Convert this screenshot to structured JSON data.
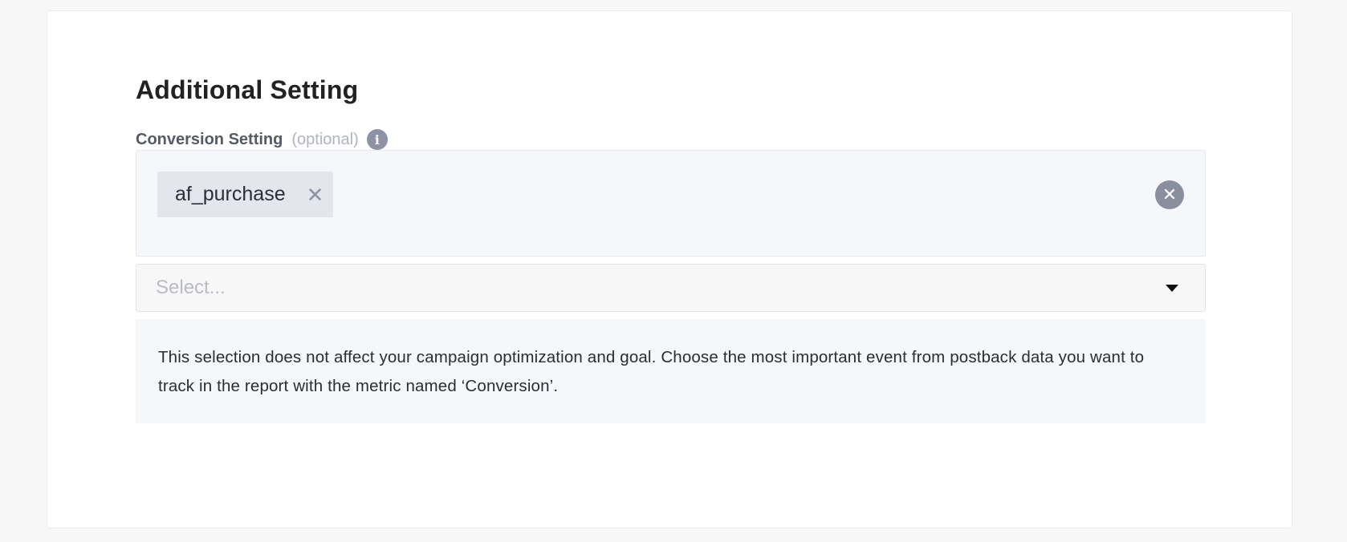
{
  "section": {
    "title": "Additional Setting"
  },
  "conversion_setting": {
    "label": "Conversion Setting",
    "optional_label": "(optional)",
    "info_icon": "info-icon",
    "selected_tags": [
      {
        "label": "af_purchase",
        "remove_icon": "close-icon"
      }
    ],
    "clear_all_icon": "circle-close-icon",
    "select": {
      "placeholder": "Select...",
      "caret_icon": "caret-down-icon"
    },
    "help_text": "This selection does not affect your campaign optimization and goal. Choose the most important event from postback data you want to track in the report with the metric named ‘Conversion’."
  },
  "colors": {
    "page_background": "#f7f7f7",
    "card_background": "#ffffff",
    "tag_background": "#e4e6ed",
    "panel_background": "#f6f7fb",
    "icon_gray": "#8a8f9f"
  }
}
